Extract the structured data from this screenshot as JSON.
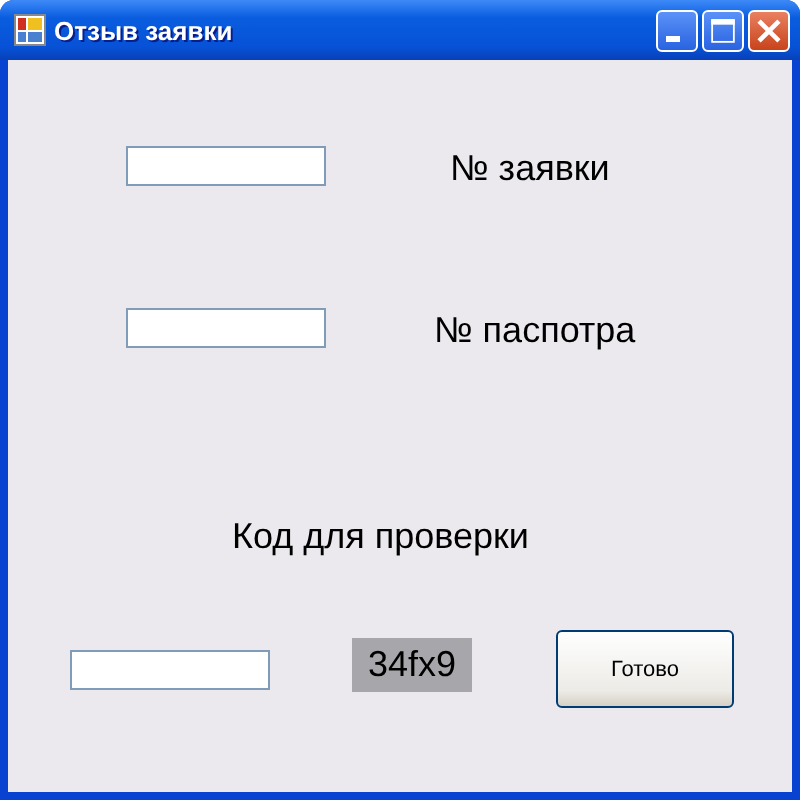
{
  "window": {
    "title": "Отзыв заявки"
  },
  "fields": [
    {
      "label": "№ заявки"
    },
    {
      "label": "№ паспотра"
    }
  ],
  "captcha": {
    "label": "Код для проверки",
    "code": "34fx9"
  },
  "buttons": [
    "Готово"
  ]
}
